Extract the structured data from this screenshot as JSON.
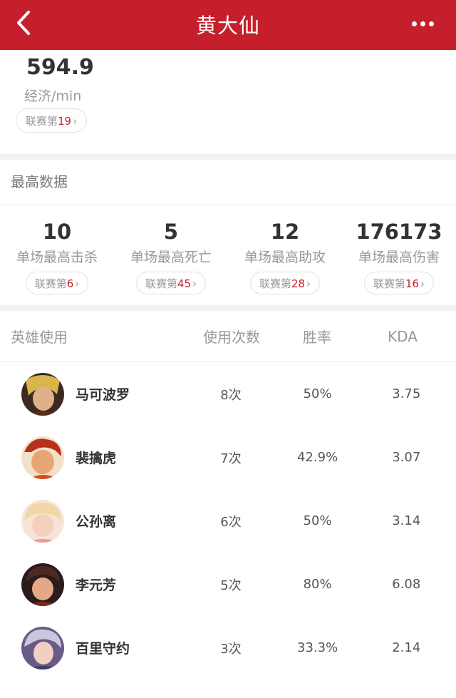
{
  "header": {
    "title": "黄大仙",
    "back_icon": "chevron-left-icon",
    "more_icon": "more-dots-icon"
  },
  "economy": {
    "value": "594.9",
    "label": "经济/min",
    "rank_prefix": "联赛第",
    "rank": "19",
    "chevron": "›"
  },
  "best": {
    "section_title": "最高数据",
    "stats": [
      {
        "value": "10",
        "label": "单场最高击杀",
        "rank_prefix": "联赛第",
        "rank": "6",
        "chevron": "›"
      },
      {
        "value": "5",
        "label": "单场最高死亡",
        "rank_prefix": "联赛第",
        "rank": "45",
        "chevron": "›"
      },
      {
        "value": "12",
        "label": "单场最高助攻",
        "rank_prefix": "联赛第",
        "rank": "28",
        "chevron": "›"
      },
      {
        "value": "176173",
        "label": "单场最高伤害",
        "rank_prefix": "联赛第",
        "rank": "16",
        "chevron": "›"
      }
    ]
  },
  "heroes": {
    "headers": {
      "hero": "英雄使用",
      "uses": "使用次数",
      "winrate": "胜率",
      "kda": "KDA"
    },
    "rows": [
      {
        "name": "马可波罗",
        "uses": "8次",
        "winrate": "50%",
        "kda": "3.75"
      },
      {
        "name": "裴擒虎",
        "uses": "7次",
        "winrate": "42.9%",
        "kda": "3.07"
      },
      {
        "name": "公孙离",
        "uses": "6次",
        "winrate": "50%",
        "kda": "3.14"
      },
      {
        "name": "李元芳",
        "uses": "5次",
        "winrate": "80%",
        "kda": "6.08"
      },
      {
        "name": "百里守约",
        "uses": "3次",
        "winrate": "33.3%",
        "kda": "2.14"
      }
    ]
  },
  "colors": {
    "brand_red": "#c41f2a",
    "rank_red": "#c41f2a",
    "muted_text": "#999999"
  }
}
